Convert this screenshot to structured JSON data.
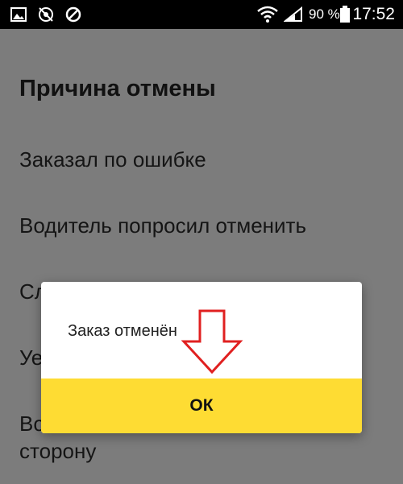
{
  "status_bar": {
    "battery_percent": "90 %",
    "time": "17:52",
    "icons": [
      "image-icon",
      "no-location-icon",
      "blocked-icon",
      "wifi-icon",
      "cellular-signal-icon",
      "battery-icon"
    ]
  },
  "screen": {
    "title": "Причина отмены",
    "reasons": [
      "Заказал по ошибке",
      "Водитель попросил отменить",
      "Сл",
      "Уе",
      "Во",
      "сторону"
    ]
  },
  "dialog": {
    "message": "Заказ отменён",
    "ok_label": "ОК",
    "button_color": "#fedc33"
  },
  "annotation": {
    "arrow_color": "#e02020",
    "icon": "down-arrow-annotation-icon"
  }
}
